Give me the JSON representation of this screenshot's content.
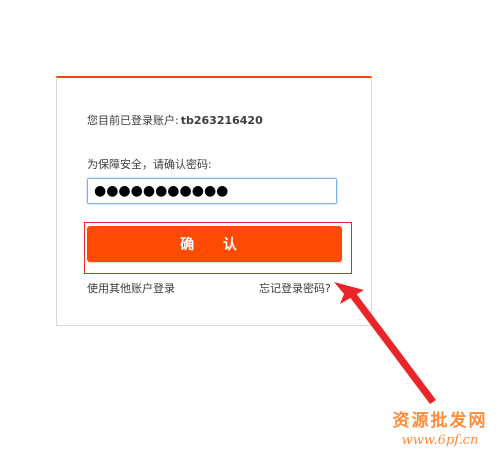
{
  "login": {
    "current_account_label": "您目前已登录账户:",
    "account_name": "tb263216420",
    "security_prompt": "为保障安全，请确认密码:",
    "password_value": "●●●●●●●●●●●",
    "confirm_label": "确 认",
    "switch_account_link": "使用其他账户登录",
    "forgot_password_link": "忘记登录密码?"
  },
  "watermark": {
    "title": "资源批发网",
    "url": "www.6pf.cn"
  },
  "colors": {
    "accent": "#ff4400",
    "button": "#ff4a03",
    "annotation_red": "#e8262a",
    "watermark": "#ff8c3a"
  }
}
